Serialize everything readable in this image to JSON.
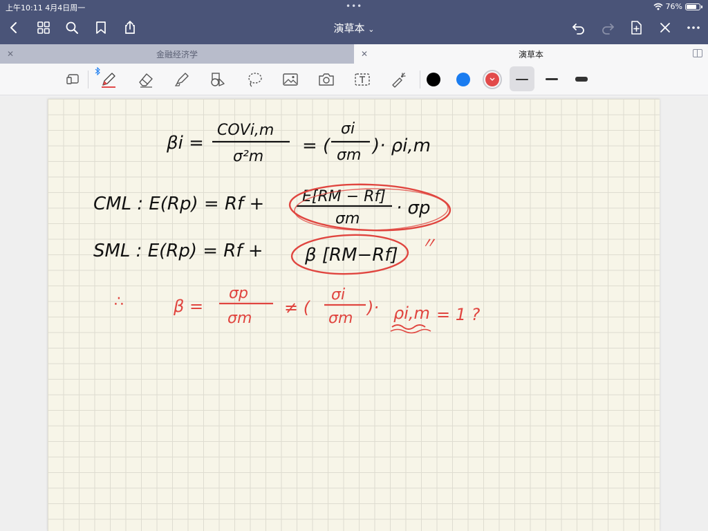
{
  "status_bar": {
    "time": "上午10:11  4月4日周一",
    "dots": "•••",
    "battery_text": "76%",
    "battery_level": 0.76
  },
  "nav": {
    "title": "演草本",
    "title_chevron": "⌄",
    "icons": [
      "back-chevron-icon",
      "grid-icon",
      "search-icon",
      "bookmark-icon",
      "share-icon",
      "undo-icon",
      "redo-icon",
      "add-page-icon",
      "close-x-icon",
      "more-icon"
    ]
  },
  "tabs": [
    {
      "label": "金融经济学",
      "active": false
    },
    {
      "label": "演草本",
      "active": true
    }
  ],
  "toolbar": {
    "tools": [
      "lasso-select-icon",
      "pen-icon",
      "eraser-icon",
      "highlighter-icon",
      "shapes-icon",
      "lasso-icon",
      "image-icon",
      "camera-icon",
      "text-icon",
      "laser-pointer-icon"
    ],
    "colors": [
      "#000000",
      "#1a7cf0",
      "#e24a4a"
    ],
    "selected_color": "#e24a4a",
    "stroke_widths": [
      "thin",
      "medium",
      "thick"
    ],
    "selected_width": "thin"
  },
  "notes": {
    "line1": {
      "lhs": "βi =",
      "num": "COVi,m",
      "den": "σ²m",
      "mid": "= (",
      "num2": "σi",
      "den2": "σm",
      "rhs": ")· ρi,m"
    },
    "line2": {
      "lhs": "CML : E(Rp) = Rf +",
      "num": "E[RM − Rf]",
      "den": "σm",
      "rhs": "· σp"
    },
    "line3": {
      "lhs": "SML : E(Rp) = Rf +",
      "circled": "β [RM−Rf]",
      "mark": "〃"
    },
    "line4": {
      "therefore": "∴",
      "beta": "β =",
      "num": "σp",
      "den": "σm",
      "neq": "≠ (",
      "num2": "σi",
      "den2": "σm",
      "close": ")·",
      "rho": "ρi,m",
      "tail": "= 1 ?"
    },
    "ink_black": "#111111",
    "ink_red": "#e0453f"
  }
}
